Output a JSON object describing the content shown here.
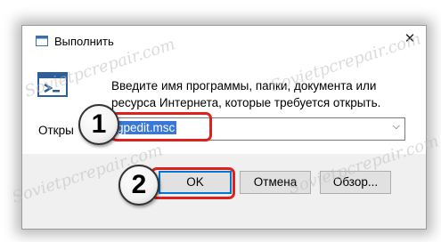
{
  "window": {
    "title": "Выполнить",
    "close_glyph": "✕"
  },
  "description": "Введите имя программы, папки, документа или ресурса Интернета, которые требуется открыть.",
  "open_label": "Открыть:",
  "open_label_visible": "Откры",
  "input": {
    "value": "gpedit.msc",
    "dropdown_glyph": "⌵"
  },
  "buttons": {
    "ok": "OK",
    "cancel": "Отмена",
    "browse": "Обзор..."
  },
  "callouts": {
    "step1": "1",
    "step2": "2"
  },
  "watermark": "Sovietpcrepair.com",
  "colors": {
    "highlight": "#e0201a",
    "selection": "#3a78d7",
    "focus": "#0078d7"
  }
}
